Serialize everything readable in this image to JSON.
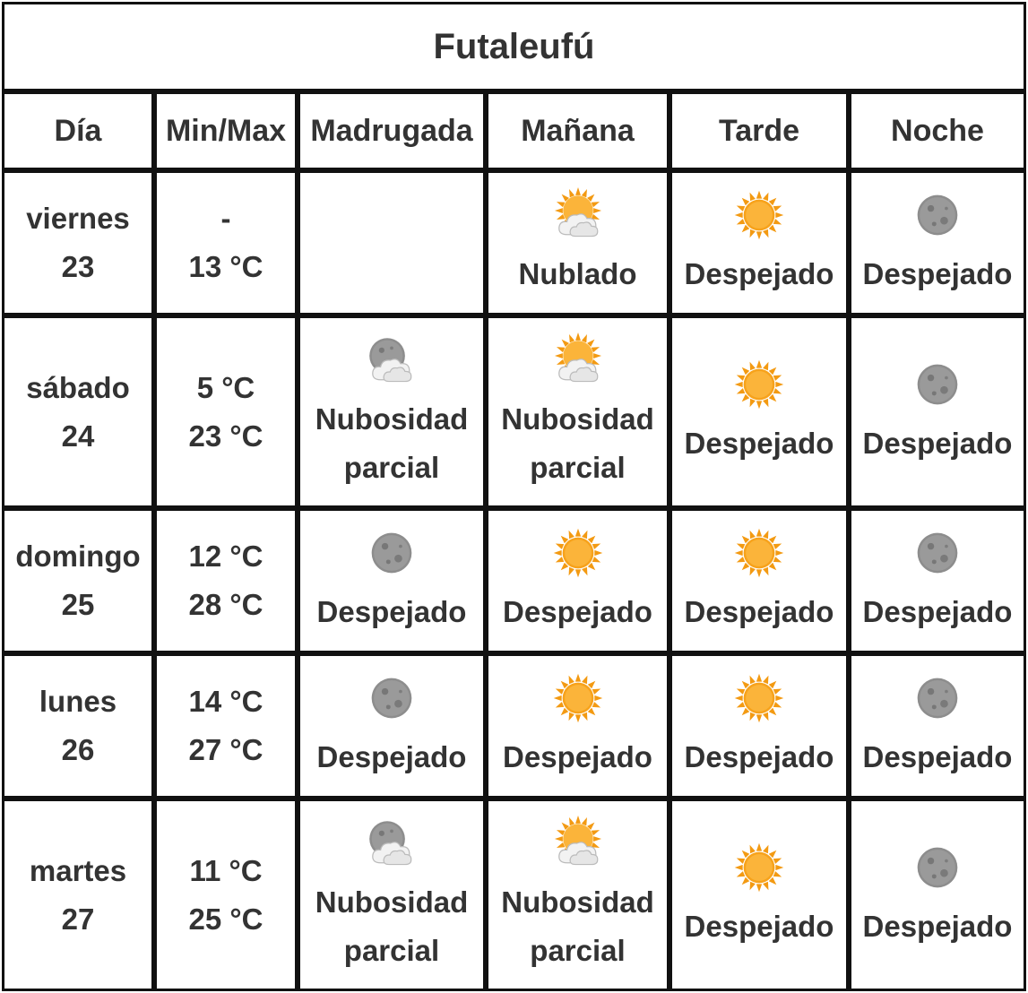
{
  "title": "Futaleufú",
  "headers": [
    "Día",
    "Min/Max",
    "Madrugada",
    "Mañana",
    "Tarde",
    "Noche"
  ],
  "rows": [
    {
      "day": "viernes",
      "date": "23",
      "min": "-",
      "max": "13 °C",
      "madrugada": {
        "icon": "",
        "label": ""
      },
      "manana": {
        "icon": "sun-cloud-icon",
        "label": "Nublado"
      },
      "tarde": {
        "icon": "sun-icon",
        "label": "Despejado"
      },
      "noche": {
        "icon": "moon-icon",
        "label": "Despejado"
      }
    },
    {
      "day": "sábado",
      "date": "24",
      "min": "5 °C",
      "max": "23 °C",
      "madrugada": {
        "icon": "moon-cloud-icon",
        "label1": "Nubosidad",
        "label2": "parcial"
      },
      "manana": {
        "icon": "sun-cloud-icon",
        "label1": "Nubosidad",
        "label2": "parcial"
      },
      "tarde": {
        "icon": "sun-icon",
        "label": "Despejado"
      },
      "noche": {
        "icon": "moon-icon",
        "label": "Despejado"
      }
    },
    {
      "day": "domingo",
      "date": "25",
      "min": "12 °C",
      "max": "28 °C",
      "madrugada": {
        "icon": "moon-icon",
        "label": "Despejado"
      },
      "manana": {
        "icon": "sun-icon",
        "label": "Despejado"
      },
      "tarde": {
        "icon": "sun-icon",
        "label": "Despejado"
      },
      "noche": {
        "icon": "moon-icon",
        "label": "Despejado"
      }
    },
    {
      "day": "lunes",
      "date": "26",
      "min": "14 °C",
      "max": "27 °C",
      "madrugada": {
        "icon": "moon-icon",
        "label": "Despejado"
      },
      "manana": {
        "icon": "sun-icon",
        "label": "Despejado"
      },
      "tarde": {
        "icon": "sun-icon",
        "label": "Despejado"
      },
      "noche": {
        "icon": "moon-icon",
        "label": "Despejado"
      }
    },
    {
      "day": "martes",
      "date": "27",
      "min": "11 °C",
      "max": "25 °C",
      "madrugada": {
        "icon": "moon-cloud-icon",
        "label1": "Nubosidad",
        "label2": "parcial"
      },
      "manana": {
        "icon": "sun-cloud-icon",
        "label1": "Nubosidad",
        "label2": "parcial"
      },
      "tarde": {
        "icon": "sun-icon",
        "label": "Despejado"
      },
      "noche": {
        "icon": "moon-icon",
        "label": "Despejado"
      }
    }
  ],
  "colors": {
    "border": "#111111",
    "text": "#333333",
    "sun": "#f7a21b",
    "moon": "#8c8c8c",
    "cloud": "#ececec"
  }
}
